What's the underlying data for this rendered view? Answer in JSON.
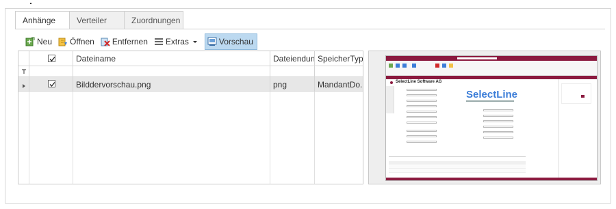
{
  "tabs": [
    {
      "label": "Anhänge",
      "active": true
    },
    {
      "label": "Verteiler",
      "active": false
    },
    {
      "label": "Zuordnungen",
      "active": false
    }
  ],
  "toolbar": {
    "new_label": "Neu",
    "open_label": "Öffnen",
    "remove_label": "Entfernen",
    "extras_label": "Extras",
    "preview_label": "Vorschau"
  },
  "grid": {
    "columns": [
      "",
      "Dateiname",
      "Dateiendung",
      "SpeicherTyp"
    ],
    "rows": [
      {
        "checked": true,
        "filename": "Bilddervorschau.png",
        "extension": "png",
        "storage": "MandantDo..."
      }
    ]
  },
  "preview": {
    "company": "SelectLine Software AG",
    "logo": "SelectLine"
  },
  "colors": {
    "accent": "#3b7dd8",
    "selected": "#bcd9f0",
    "preview_brand": "#8b1a3f"
  }
}
